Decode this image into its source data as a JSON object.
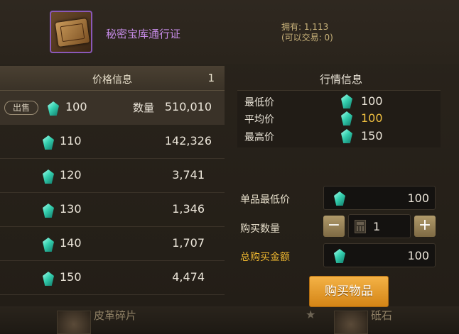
{
  "item": {
    "name": "秘密宝库通行证",
    "owned_line": "拥有: 1,113",
    "tradable_line": "(可以交易: 0)"
  },
  "price_info": {
    "title": "价格信息",
    "page": "1",
    "sell_label": "出售",
    "qty_label": "数量",
    "rows": [
      {
        "price": "100",
        "qty": "510,010"
      },
      {
        "price": "110",
        "qty": "142,326"
      },
      {
        "price": "120",
        "qty": "3,741"
      },
      {
        "price": "130",
        "qty": "1,346"
      },
      {
        "price": "140",
        "qty": "1,707"
      },
      {
        "price": "150",
        "qty": "4,474"
      }
    ]
  },
  "market": {
    "title": "行情信息",
    "min_label": "最低价",
    "min_value": "100",
    "avg_label": "平均价",
    "avg_value": "100",
    "max_label": "最高价",
    "max_value": "150"
  },
  "purchase": {
    "unit_price_label": "单品最低价",
    "unit_price": "100",
    "qty_label": "购买数量",
    "qty": "1",
    "minus": "−",
    "plus": "+",
    "total_label": "总购买金额",
    "total": "100",
    "buy_button": "购买物品"
  },
  "background": {
    "left_text": "皮革碎片",
    "right_text": "砥石"
  },
  "colors": {
    "item_name": "#c58be6",
    "avg_price": "#f0c040",
    "total_label": "#f0b830",
    "buy_button": "#e89c2c",
    "gem": "#36d1b0"
  },
  "icons": {
    "currency": "gem-icon",
    "calculator": "calculator-icon",
    "item": "vault-pass-icon"
  }
}
